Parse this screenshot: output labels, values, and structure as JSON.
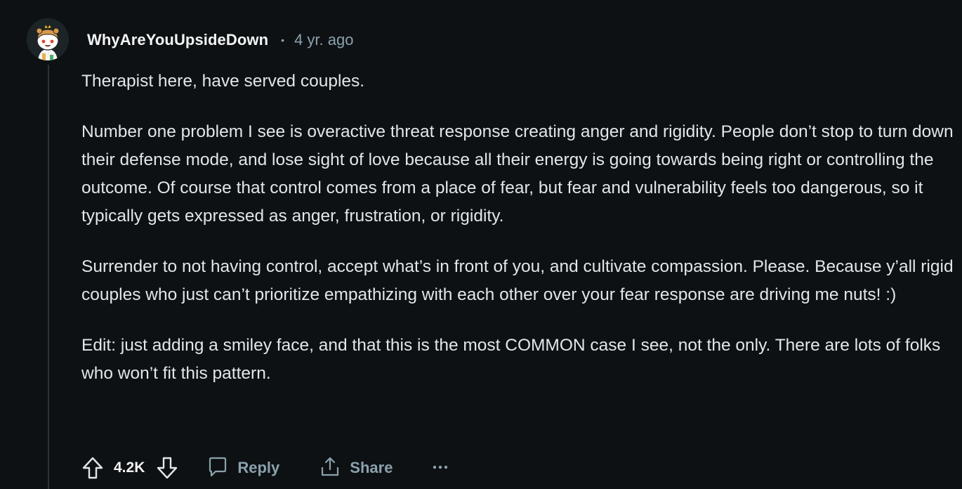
{
  "comment": {
    "username": "WhyAreYouUpsideDown",
    "separator": "•",
    "timestamp": "4 yr. ago",
    "avatar_icon": "snoo-avatar-icon",
    "paragraphs": [
      "Therapist here, have served couples.",
      "Number one problem I see is overactive threat response creating anger and rigidity. People don’t stop to turn down their defense mode, and lose sight of love because all their energy is going towards being right or controlling the outcome. Of course that control comes from a place of fear, but fear and vulnerability feels too dangerous, so it typically gets expressed as anger, frustration, or rigidity.",
      "Surrender to not having control, accept what’s in front of you, and cultivate compassion. Please. Because y’all rigid couples who just can’t prioritize empathizing with each other over your fear response are driving me nuts! :)",
      "Edit: just adding a smiley face, and that this is the most COMMON case I see, not the only. There are lots of folks who won’t fit this pattern."
    ]
  },
  "actions": {
    "score": "4.2K",
    "reply_label": "Reply",
    "share_label": "Share",
    "icons": {
      "upvote": "upvote-arrow-icon",
      "downvote": "downvote-arrow-icon",
      "reply": "speech-bubble-icon",
      "share": "share-upload-icon",
      "more": "overflow-dots-icon"
    }
  },
  "colors": {
    "background": "#0e1113",
    "text": "#e3e6e8",
    "muted": "#8ba2ad",
    "thread_line": "#2a3236"
  }
}
